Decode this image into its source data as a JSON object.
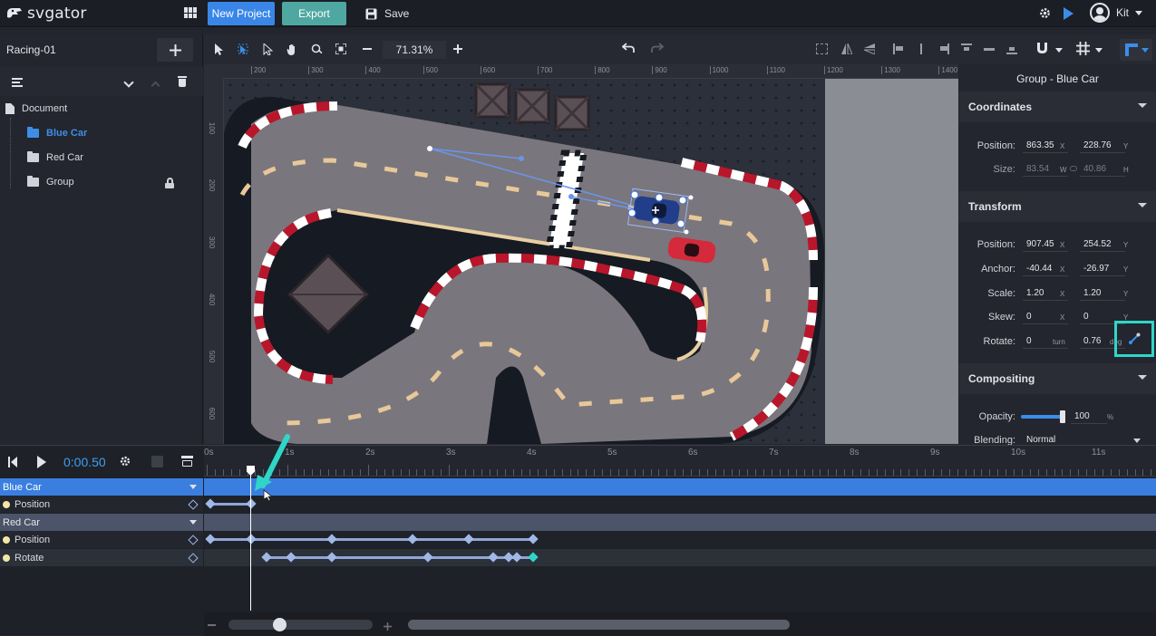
{
  "topbar": {
    "logo_text": "svgator",
    "new_project": "New Project",
    "export": "Export",
    "save": "Save",
    "user": "Kit"
  },
  "project": {
    "name": "Racing-01"
  },
  "layers": {
    "root": "Document",
    "items": [
      {
        "label": "Blue Car",
        "selected": true
      },
      {
        "label": "Red Car",
        "selected": false
      },
      {
        "label": "Group",
        "selected": false,
        "locked": true
      }
    ]
  },
  "toolbar": {
    "zoom": "71.31%"
  },
  "rulers": {
    "h": [
      "200",
      "300",
      "400",
      "500",
      "600",
      "700",
      "800",
      "900",
      "1000",
      "1100",
      "1200",
      "1300",
      "1400"
    ],
    "v": [
      "100",
      "200",
      "300",
      "400",
      "500",
      "600"
    ]
  },
  "inspector": {
    "title": "Group - Blue Car",
    "coordinates": {
      "heading": "Coordinates",
      "position_label": "Position:",
      "pos_x": "863.35",
      "pos_y": "228.76",
      "size_label": "Size:",
      "w": "83.54",
      "h": "40.86"
    },
    "transform": {
      "heading": "Transform",
      "position_label": "Position:",
      "pos_x": "907.45",
      "pos_y": "254.52",
      "anchor_label": "Anchor:",
      "anchor_x": "-40.44",
      "anchor_y": "-26.97",
      "scale_label": "Scale:",
      "scale_x": "1.20",
      "scale_y": "1.20",
      "skew_label": "Skew:",
      "skew_x": "0",
      "skew_y": "0",
      "rotate_label": "Rotate:",
      "rotate_turn": "0",
      "rotate_deg": "0.76"
    },
    "compositing": {
      "heading": "Compositing",
      "opacity_label": "Opacity:",
      "opacity": "100",
      "opacity_fraction": 1.0,
      "blending_label": "Blending:",
      "blending": "Normal"
    },
    "units": {
      "x": "X",
      "y": "Y",
      "w": "W",
      "h": "H",
      "turn": "turn",
      "deg": "deg",
      "pct": "%"
    }
  },
  "timeline": {
    "time": "0:00.50",
    "ticks": [
      "0s",
      "1s",
      "2s",
      "3s",
      "4s",
      "5s",
      "6s",
      "7s",
      "8s",
      "9s",
      "10s",
      "11s"
    ],
    "tracks": [
      {
        "label": "Blue Car",
        "type": "group",
        "selected": true
      },
      {
        "label": "Position",
        "type": "prop"
      },
      {
        "label": "Red Car",
        "type": "group"
      },
      {
        "label": "Position",
        "type": "prop"
      },
      {
        "label": "Rotate",
        "type": "prop"
      }
    ]
  }
}
